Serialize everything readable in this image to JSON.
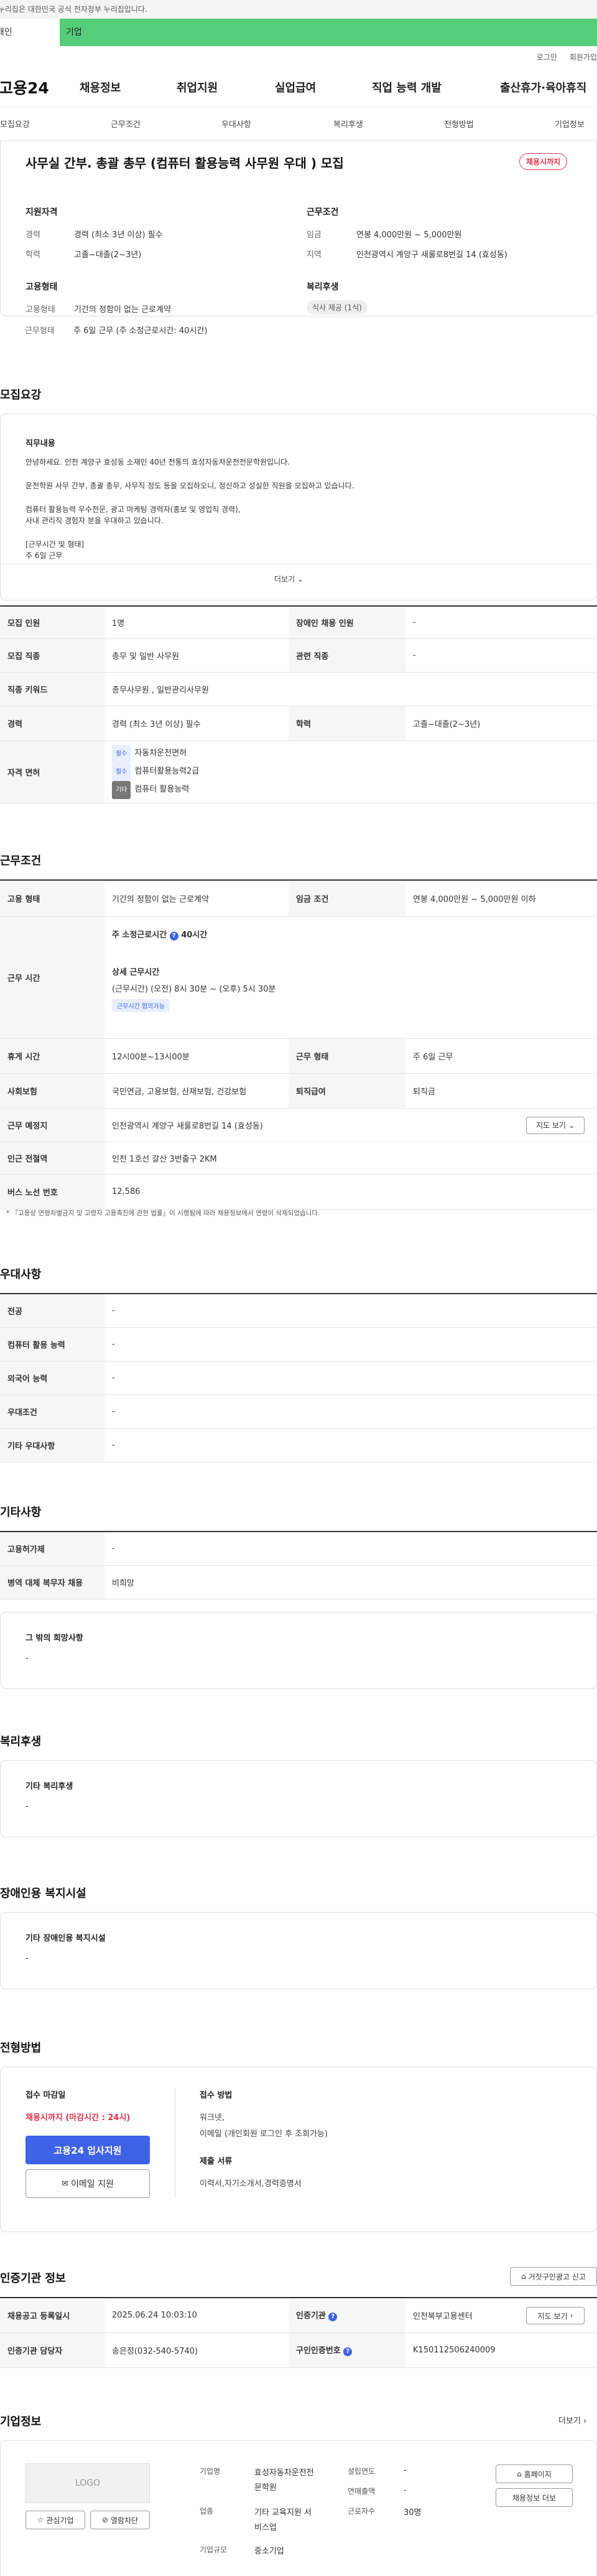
{
  "gov_banner": "이 누리집은 대한민국 공식 전자정부 누리집입니다.",
  "topbar": {
    "left": "개인",
    "right": "기업"
  },
  "util": {
    "login": "로그인",
    "signup": "회원가입"
  },
  "gnb": {
    "logo": "고용24",
    "menu": [
      "채용정보",
      "취업지원",
      "실업급여",
      "직업 능력 개발",
      "출산휴가·육아휴직"
    ]
  },
  "subnav": [
    "모집요강",
    "근무조건",
    "우대사항",
    "복리후생",
    "전형방법",
    "기업정보"
  ],
  "summary": {
    "title": "사무실 간부. 총괄 총무 (컴퓨터 활용능력 사무원 우대 ) 모집",
    "badge": "채용시까지",
    "qual_title": "지원자격",
    "career_lbl": "경력",
    "career_val": "경력 (최소 3년 이상) 필수",
    "edu_lbl": "학력",
    "edu_val": "고졸~대졸(2~3년)",
    "form_title": "고용형태",
    "emp_lbl": "고용형태",
    "emp_val": "기간의 정함이 없는 근로계약",
    "work_lbl": "근무형태",
    "work_val": "주 6일 근무 (주 소정근로시간: 40시간)",
    "cond_title": "근무조건",
    "wage_lbl": "임금",
    "wage_val": "연봉 4,000만원 ~ 5,000만원",
    "region_lbl": "지역",
    "region_val": "인천광역시 계양구 새룰로8번길 14 (효성동)",
    "welfare_title": "복리후생",
    "welfare_pill": "식사 제공 (1식)"
  },
  "recruit": {
    "title": "모집요강",
    "job_title": "직무내용",
    "lines": [
      "안녕하세요. 인천 계양구 효성동 소재인 40년 전통의 효성자동차운전전문학원입니다.",
      "운전학원 사무 간부, 총괄 총무, 사무직 정도 등을 모집하오니, 정신하고 성실한 직원을 모집하고 있습니다.",
      "컴퓨터 활용능력 우수전문, 광고 마케팅 경력자(홍보 및 영업직 경력),",
      "사내 관리직 경험자 분을 우대하고 있습니다.",
      "[근무시간 및 형태]",
      "주 6일 근무"
    ],
    "more": "더보기",
    "table": [
      [
        "모집 인원",
        "1명",
        "장애인 채용 인원",
        "-"
      ],
      [
        "모집 직종",
        "총무 및 일반 사무원",
        "관련 직종",
        "-"
      ],
      [
        "직종 키워드",
        "총무사무원 , 일반관리사무원",
        "",
        ""
      ],
      [
        "경력",
        "경력 (최소 3년 이상) 필수",
        "학력",
        "고졸~대졸(2~3년)"
      ]
    ],
    "license_lbl": "자격 면허",
    "licenses": [
      {
        "tag": "필수",
        "name": "자동차운전면허"
      },
      {
        "tag": "필수",
        "name": "컴퓨터활용능력2급"
      },
      {
        "tag": "기타",
        "name": "컴퓨터 활용능력"
      }
    ]
  },
  "workcond": {
    "title": "근무조건",
    "emp_lbl": "고용 형태",
    "emp_val": "기간의 정함이 없는 근로계약",
    "wage_lbl": "임금 조건",
    "wage_val": "연봉 4,000만원 ~ 5,000만원 이하",
    "hours_lbl": "근무 시간",
    "weekly": "주 소정근로시간",
    "weekly_val": "40시간",
    "detail_title": "상세 근무시간",
    "detail_val": "(근무시간) (오전) 8시 30분 ~ (오후) 5시 30분",
    "flex_tag": "근무시간 협의가능",
    "break_lbl": "휴게 시간",
    "break_val": "12시00분~13시00분",
    "type_lbl": "근무 형태",
    "type_val": "주 6일 근무",
    "ins_lbl": "사회보험",
    "ins_val": "국민연금, 고용보험, 산재보험, 건강보험",
    "ret_lbl": "퇴직급여",
    "ret_val": "퇴직금",
    "place_lbl": "근무 예정지",
    "place_val": "인천광역시 계양구 새룰로8번길 14 (효성동)",
    "map_btn": "지도 보기",
    "subway_lbl": "인근 전철역",
    "subway_val": "인천 1호선 갈산 3번출구 2KM",
    "bus_lbl": "버스 노선 번호",
    "bus_val": "12,586",
    "note": "* 『고용상 연령차별금지 및 고령자 고용촉진에 관한 법률』이 시행됨에 따라 채용정보에서 연령이 삭제되었습니다."
  },
  "pref": {
    "title": "우대사항",
    "rows": [
      [
        "전공",
        "-"
      ],
      [
        "컴퓨터 활용 능력",
        "-"
      ],
      [
        "외국어 능력",
        "-"
      ],
      [
        "우대조건",
        "-"
      ],
      [
        "기타 우대사항",
        "-"
      ]
    ]
  },
  "etc": {
    "title": "기타사항",
    "rows": [
      [
        "고용허가제",
        "-"
      ],
      [
        "병역 대체 복무자 채용",
        "비희망"
      ]
    ],
    "box_title": "그 밖의 희망사항",
    "box_val": "-"
  },
  "welfare": {
    "title": "복리후생",
    "box_title": "기타 복리후생",
    "box_val": "-"
  },
  "disabled": {
    "title": "장애인용 복지시설",
    "box_title": "기타 장애인용 복지시설",
    "box_val": "-"
  },
  "process": {
    "title": "전형방법",
    "deadline_title": "접수 마감일",
    "deadline_val": "채용시까지 (마감시간 : 24시)",
    "apply_btn": "고용24 입사지원",
    "email_btn": "이메일 지원",
    "method_title": "접수 방법",
    "method_val1": "워크넷,",
    "method_val2": "이메일 (개인회원 로그인 후 조회가능)",
    "docs_title": "제출 서류",
    "docs_val": "이력서,자기소개서,경력증명서"
  },
  "agency": {
    "title": "인증기관 정보",
    "report_btn": "거짓구인광고 신고",
    "reg_lbl": "채용공고 등록일시",
    "reg_val": "2025.06.24 10:03:10",
    "org_lbl": "인증기관",
    "org_val": "인천북부고용센터",
    "map_btn": "지도 보기",
    "mgr_lbl": "인증기관 담당자",
    "mgr_val": "송은정(032-540-5740)",
    "no_lbl": "구인인증번호",
    "no_val": "K150112506240009"
  },
  "company": {
    "title": "기업정보",
    "more": "더보기",
    "logo": "LOGO",
    "fav_btn": "관심기업",
    "block_btn": "열람차단",
    "name_lbl": "기업명",
    "name_val1": "효성자동차운전전",
    "name_val2": "문학원",
    "biz_lbl": "업종",
    "biz_val1": "기타 교육지원 서",
    "biz_val2": "비스업",
    "size_lbl": "기업규모",
    "size_val": "중소기업",
    "found_lbl": "설립연도",
    "found_val": "-",
    "sales_lbl": "연매출액",
    "sales_val": "-",
    "emp_lbl": "근로자수",
    "emp_val": "30명",
    "home_btn": "홈페이지",
    "list_btn": "채용정보 더보"
  }
}
